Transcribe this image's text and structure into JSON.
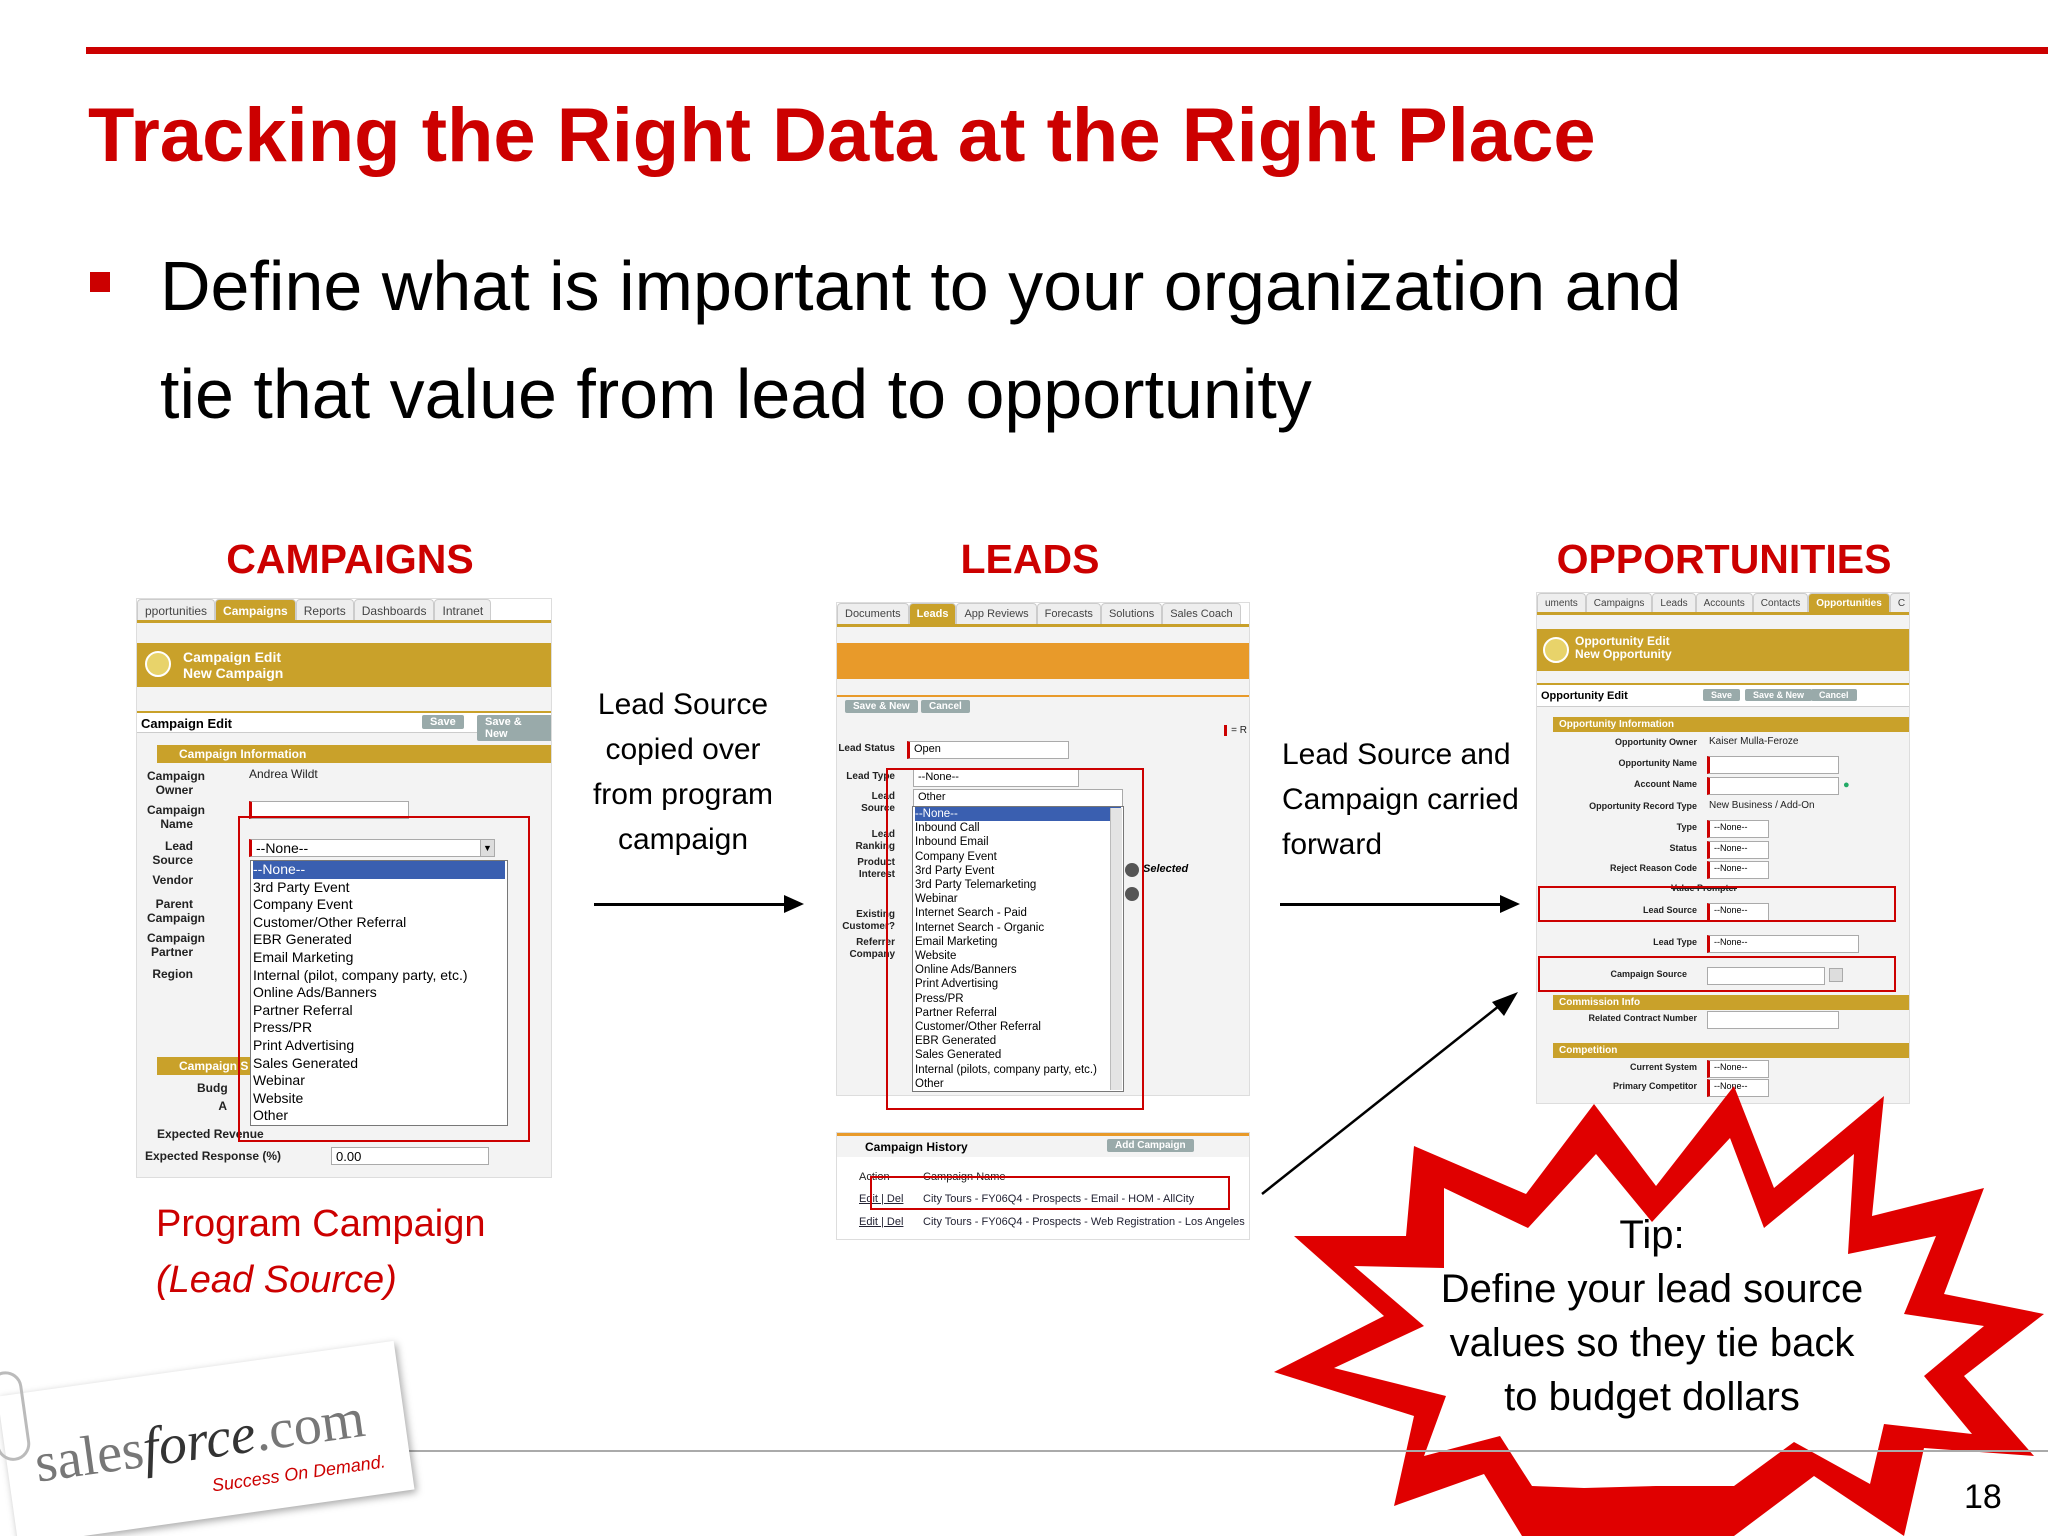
{
  "slide": {
    "title": "Tracking the Right Data at the Right Place",
    "bullet_line1": "Define what is important to your organization and",
    "bullet_line2": "tie that value from lead to opportunity",
    "page_number": "18",
    "colors": {
      "accent": "#cc0000",
      "gold": "#c9a12a"
    }
  },
  "sections": {
    "campaigns": "CAMPAIGNS",
    "leads": "LEADS",
    "opportunities": "OPPORTUNITIES"
  },
  "campaign_panel": {
    "tabs": [
      "pportunities",
      "Campaigns",
      "Reports",
      "Dashboards",
      "Intranet"
    ],
    "header_line1": "Campaign Edit",
    "header_line2": "New Campaign",
    "edit_title": "Campaign Edit",
    "save": "Save",
    "save_new": "Save & New",
    "section_info": "Campaign Information",
    "owner_label": "Campaign Owner",
    "owner_value": "Andrea Wildt",
    "name_label": "Campaign Name",
    "lead_source_label": "Lead Source",
    "vendor_label": "Vendor",
    "parent_label": "Parent Campaign",
    "partner_label": "Campaign Partner",
    "region_label": "Region",
    "dropdown_value": "--None--",
    "options": [
      "--None--",
      "3rd Party Event",
      "Company Event",
      "Customer/Other Referral",
      "EBR Generated",
      "Email Marketing",
      "Internal (pilot, company party, etc.)",
      "Online Ads/Banners",
      "Partner Referral",
      "Press/PR",
      "Print Advertising",
      "Sales Generated",
      "Webinar",
      "Website",
      "Other"
    ],
    "section_stats": "Campaign S",
    "budget_label": "Budg",
    "actual_label": "A",
    "expected_revenue_label": "Expected Revenue",
    "expected_response_label": "Expected Response (%)",
    "expected_response_value": "0.00"
  },
  "leads_panel": {
    "tabs": [
      "Documents",
      "Leads",
      "App Reviews",
      "Forecasts",
      "Solutions",
      "Sales Coach"
    ],
    "save_new": "Save & New",
    "cancel": "Cancel",
    "required_hint": "= R",
    "lead_status_label": "Lead Status",
    "lead_status_value": "Open",
    "lead_type_label": "Lead Type",
    "lead_type_value": "--None--",
    "lead_source_label": "Lead Source",
    "lead_source_value": "Other",
    "lead_ranking_label": "Lead Ranking",
    "product_interest_label": "Product Interest",
    "existing_customer_label": "Existing Customer?",
    "referrer_label": "Referrer Company",
    "selected_label": "Selected",
    "options": [
      "--None--",
      "Inbound Call",
      "Inbound Email",
      "Company Event",
      "3rd Party Event",
      "3rd Party Telemarketing",
      "Webinar",
      "Internet Search - Paid",
      "Internet Search - Organic",
      "Email Marketing",
      "Website",
      "Online Ads/Banners",
      "Print Advertising",
      "Press/PR",
      "Partner Referral",
      "Customer/Other Referral",
      "EBR Generated",
      "Sales Generated",
      "Internal (pilots, company party, etc.)",
      "Other"
    ],
    "history_title": "Campaign History",
    "add_campaign": "Add Campaign",
    "col_action": "Action",
    "col_name": "Campaign Name",
    "rows": [
      {
        "action": "Edit | Del",
        "name": "City Tours - FY06Q4 - Prospects - Email - HOM - AllCity"
      },
      {
        "action": "Edit | Del",
        "name": "City Tours - FY06Q4 - Prospects - Web Registration - Los Angeles"
      }
    ]
  },
  "opp_panel": {
    "tabs": [
      "uments",
      "Campaigns",
      "Leads",
      "Accounts",
      "Contacts",
      "Opportunities",
      "C"
    ],
    "header_line1": "Opportunity Edit",
    "header_line2": "New Opportunity",
    "edit_title": "Opportunity Edit",
    "save": "Save",
    "save_new": "Save & New",
    "cancel": "Cancel",
    "section_info": "Opportunity Information",
    "owner_label": "Opportunity Owner",
    "owner_value": "Kaiser Mulla-Feroze",
    "name_label": "Opportunity Name",
    "account_label": "Account Name",
    "record_type_label": "Opportunity Record Type",
    "record_type_value": "New Business / Add-On",
    "type_label": "Type",
    "status_label": "Status",
    "reject_label": "Reject Reason Code",
    "value_prompter_label": "Value Prompter",
    "lead_source_label": "Lead Source",
    "lead_type_label": "Lead Type",
    "campaign_source_label": "Campaign Source",
    "none_value": "--None--",
    "section_commission": "Commission Info",
    "related_contract_label": "Related Contract Number",
    "section_competition": "Competition",
    "current_system_label": "Current System",
    "primary_competitor_label": "Primary Competitor"
  },
  "captions": {
    "copied_over": [
      "Lead Source",
      "copied over",
      "from program",
      "campaign"
    ],
    "carried_forward": [
      "Lead Source and",
      "Campaign carried",
      "forward"
    ],
    "program_campaign": "Program Campaign",
    "lead_source_paren": "(Lead Source)",
    "tip_title": "Tip:",
    "tip_lines": [
      "Define your lead source",
      "values so they tie back",
      "to budget dollars"
    ]
  },
  "logo": {
    "brand_sales": "sales",
    "brand_force": "force",
    "brand_com": ".com",
    "tagline": "Success On Demand."
  }
}
